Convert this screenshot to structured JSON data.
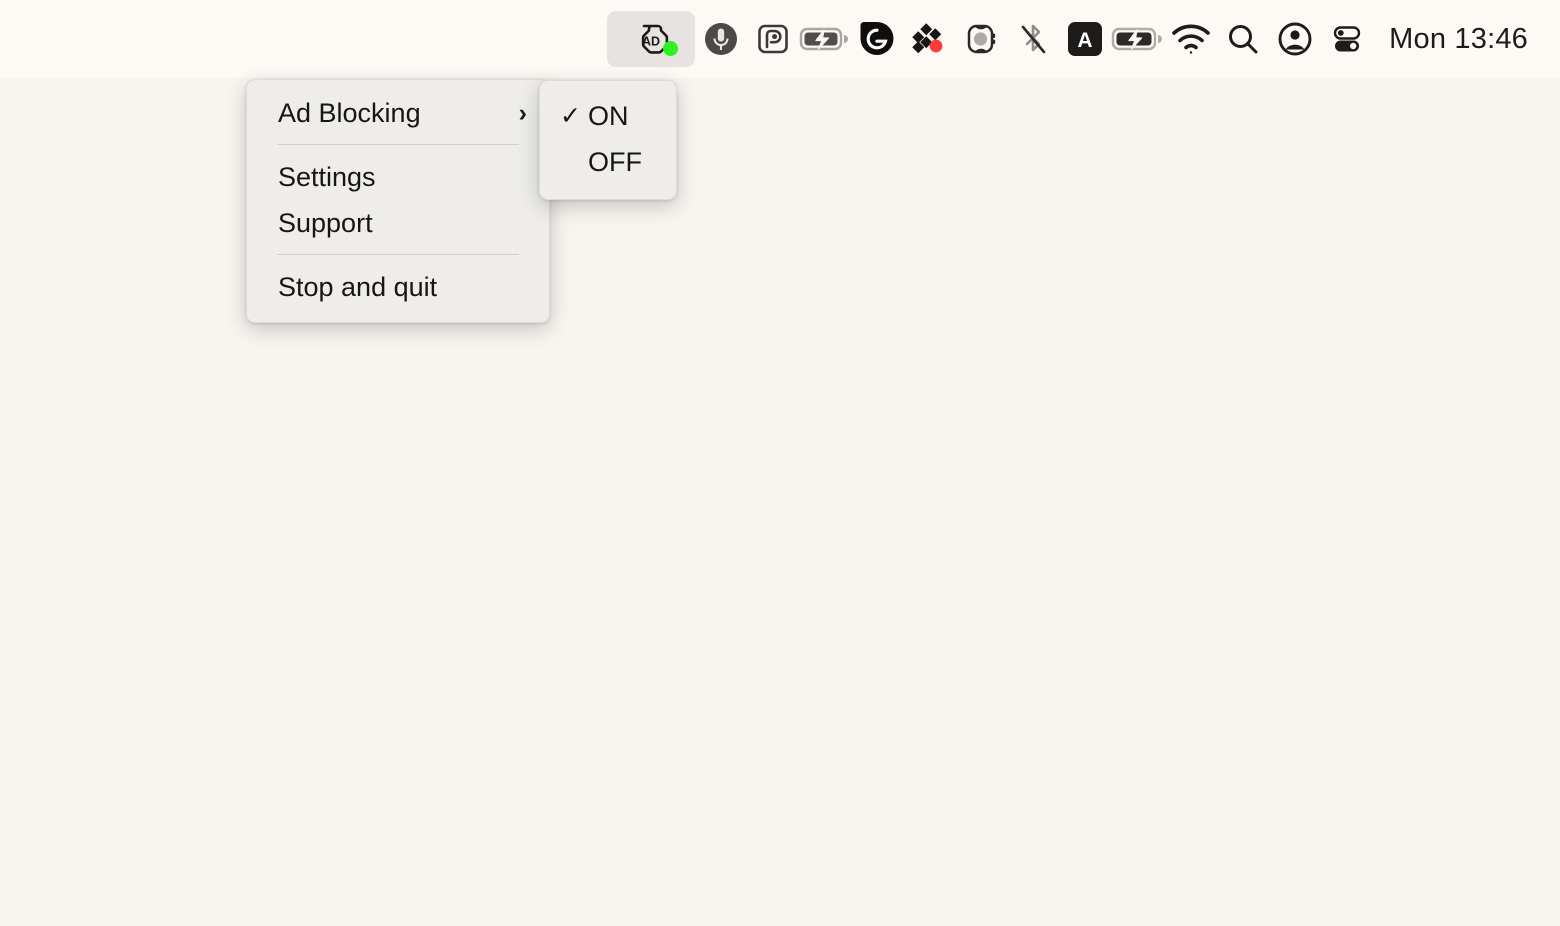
{
  "desktop": {
    "background_color": "#f8f4f0"
  },
  "menubar": {
    "background_color": "#fdfaf6",
    "clock": "Mon 13:46",
    "items": [
      {
        "icon": "adblock-icon",
        "name": "adblock",
        "active": true,
        "status_dot": "#2ff020"
      },
      {
        "icon": "microphone-icon",
        "name": "microphone",
        "active": false
      },
      {
        "icon": "pocket-p-icon",
        "name": "pocket",
        "active": false
      },
      {
        "icon": "battery-charging-icon",
        "name": "battery-external",
        "active": false
      },
      {
        "icon": "grammarly-icon",
        "name": "grammarly",
        "active": false
      },
      {
        "icon": "diamond-cluster-icon",
        "name": "sync-app",
        "active": false,
        "badge_color": "#f93b3b"
      },
      {
        "icon": "apple-watch-icon",
        "name": "apple-watch",
        "active": false
      },
      {
        "icon": "bluetooth-off-icon",
        "name": "bluetooth",
        "active": false
      },
      {
        "icon": "input-source-a-icon",
        "name": "input-source",
        "active": false,
        "letter": "A"
      },
      {
        "icon": "battery-charging-icon",
        "name": "battery",
        "active": false
      },
      {
        "icon": "wifi-icon",
        "name": "wifi",
        "active": false
      },
      {
        "icon": "search-icon",
        "name": "spotlight",
        "active": false
      },
      {
        "icon": "user-account-icon",
        "name": "user-account",
        "active": false
      },
      {
        "icon": "control-center-icon",
        "name": "control-center",
        "active": false
      }
    ]
  },
  "menu": {
    "background_color": "#eeedeb",
    "items": [
      {
        "label": "Ad Blocking",
        "has_submenu": true,
        "chevron": "›"
      },
      {
        "type": "separator"
      },
      {
        "label": "Settings",
        "has_submenu": false
      },
      {
        "label": "Support",
        "has_submenu": false
      },
      {
        "type": "separator"
      },
      {
        "label": "Stop and quit",
        "has_submenu": false
      }
    ]
  },
  "submenu": {
    "parent": "Ad Blocking",
    "background_color": "#eeedeb",
    "checkmark": "✓",
    "items": [
      {
        "label": "ON",
        "checked": true
      },
      {
        "label": "OFF",
        "checked": false
      }
    ]
  }
}
